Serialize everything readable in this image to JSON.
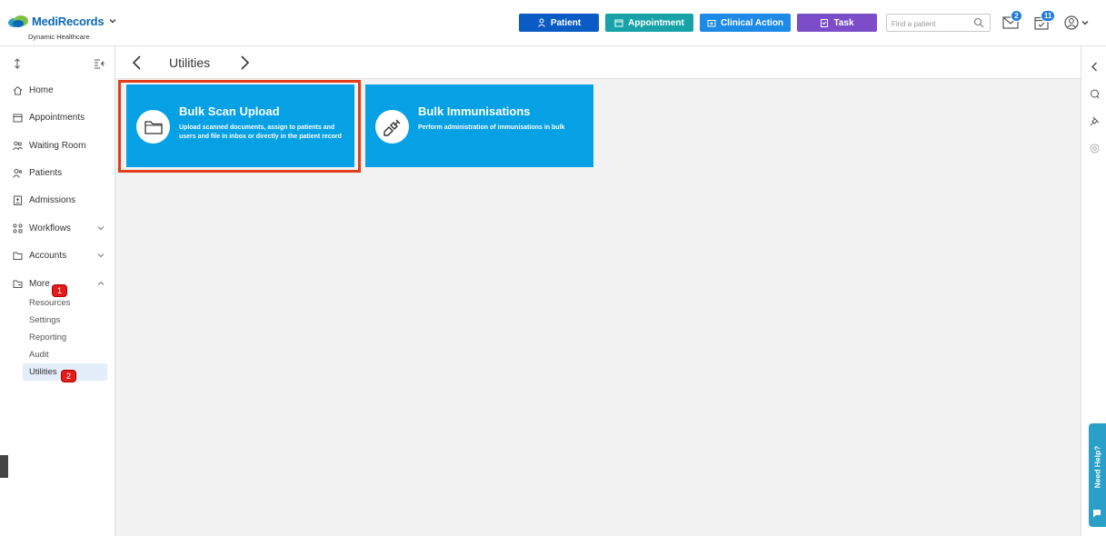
{
  "header": {
    "brand": "MediRecords",
    "brand_subtitle": "Dynamic Healthcare",
    "buttons": {
      "patient": "Patient",
      "appointment": "Appointment",
      "clinical_action": "Clinical Action",
      "task": "Task"
    },
    "search_placeholder": "Find a patient",
    "mail_count": "2",
    "task_count": "11",
    "colors": {
      "patient": "#0a5bc4",
      "appointment": "#17a2a8",
      "clinical_action": "#1c8ae6",
      "task": "#7c4dc9"
    }
  },
  "sidebar": {
    "items": [
      {
        "label": "Home",
        "icon": "home-icon"
      },
      {
        "label": "Appointments",
        "icon": "calendar-icon"
      },
      {
        "label": "Waiting Room",
        "icon": "people-icon"
      },
      {
        "label": "Patients",
        "icon": "patients-icon"
      },
      {
        "label": "Admissions",
        "icon": "hospital-icon"
      },
      {
        "label": "Workflows",
        "icon": "workflow-icon"
      },
      {
        "label": "Accounts",
        "icon": "folder-icon"
      },
      {
        "label": "More",
        "icon": "more-icon"
      }
    ],
    "more_subitems": [
      "Resources",
      "Settings",
      "Reporting",
      "Audit",
      "Utilities"
    ],
    "active": "Utilities"
  },
  "annotations": {
    "step1": "1",
    "step2": "2"
  },
  "main": {
    "title": "Utilities",
    "cards": [
      {
        "title": "Bulk Scan Upload",
        "description": "Upload scanned documents, assign to patients and users and file in inbox or directly in the patient record",
        "icon": "folder-icon"
      },
      {
        "title": "Bulk Immunisations",
        "description": "Perform administration of immunisations in bulk",
        "icon": "syringe-icon"
      }
    ]
  },
  "help": {
    "label": "Need Help?"
  }
}
